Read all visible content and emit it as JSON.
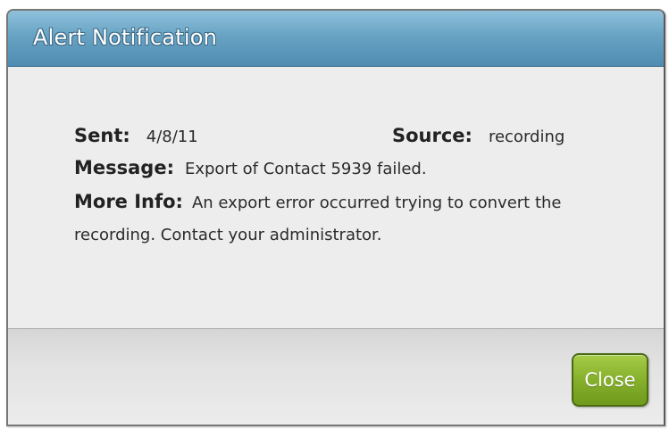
{
  "dialog": {
    "title": "Alert Notification",
    "sent_label": "Sent:",
    "sent_value": "4/8/11",
    "source_label": "Source:",
    "source_value": "recording",
    "message_label": "Message:",
    "message_value": "Export of Contact 5939 failed.",
    "more_info_label": "More Info:",
    "more_info_value": "An export error occurred trying to convert the recording. Contact your administrator.",
    "close_label": "Close"
  },
  "colors": {
    "titlebar": "#68a3c4",
    "close_button": "#86b02c",
    "body": "#ededed"
  }
}
